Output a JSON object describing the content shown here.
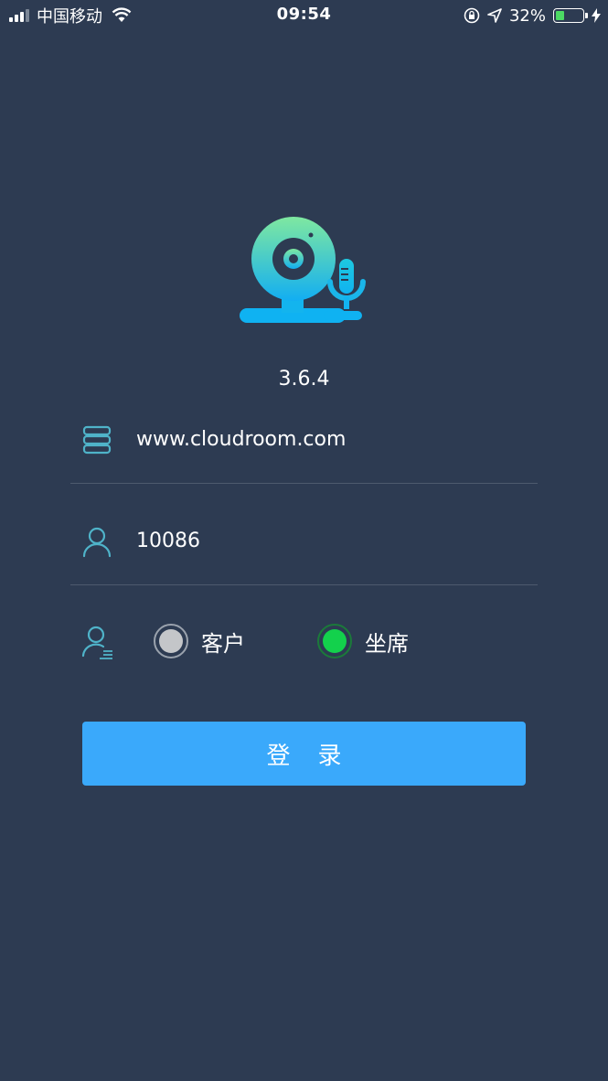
{
  "status_bar": {
    "carrier": "中国移动",
    "time": "09:54",
    "battery_percent": "32%",
    "battery_level": 0.32,
    "icons": [
      "signal-icon",
      "wifi-icon",
      "orientation-lock-icon",
      "location-icon",
      "battery-icon",
      "charging-icon"
    ]
  },
  "app": {
    "logo": "webcam-microphone-logo",
    "version": "3.6.4"
  },
  "form": {
    "server": {
      "value": "www.cloudroom.com",
      "icon": "server-icon"
    },
    "account": {
      "value": "10086",
      "icon": "user-icon"
    },
    "role": {
      "icon": "user-role-icon",
      "options": [
        {
          "label": "客户",
          "selected": false
        },
        {
          "label": "坐席",
          "selected": true
        }
      ]
    },
    "login_label": "登录"
  },
  "colors": {
    "background": "#2d3b52",
    "accent": "#3aa9fb",
    "radio_selected": "#13d14c",
    "icon_teal": "#4fb3c9"
  }
}
